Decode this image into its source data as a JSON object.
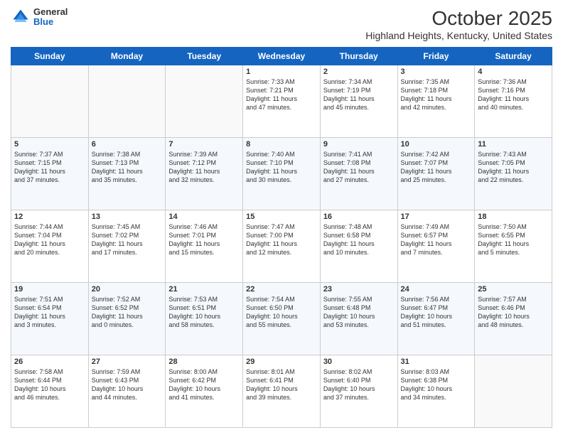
{
  "logo": {
    "general": "General",
    "blue": "Blue"
  },
  "title": "October 2025",
  "subtitle": "Highland Heights, Kentucky, United States",
  "days_header": [
    "Sunday",
    "Monday",
    "Tuesday",
    "Wednesday",
    "Thursday",
    "Friday",
    "Saturday"
  ],
  "weeks": [
    {
      "cells": [
        {
          "day": "",
          "info": ""
        },
        {
          "day": "",
          "info": ""
        },
        {
          "day": "",
          "info": ""
        },
        {
          "day": "1",
          "info": "Sunrise: 7:33 AM\nSunset: 7:21 PM\nDaylight: 11 hours\nand 47 minutes."
        },
        {
          "day": "2",
          "info": "Sunrise: 7:34 AM\nSunset: 7:19 PM\nDaylight: 11 hours\nand 45 minutes."
        },
        {
          "day": "3",
          "info": "Sunrise: 7:35 AM\nSunset: 7:18 PM\nDaylight: 11 hours\nand 42 minutes."
        },
        {
          "day": "4",
          "info": "Sunrise: 7:36 AM\nSunset: 7:16 PM\nDaylight: 11 hours\nand 40 minutes."
        }
      ]
    },
    {
      "cells": [
        {
          "day": "5",
          "info": "Sunrise: 7:37 AM\nSunset: 7:15 PM\nDaylight: 11 hours\nand 37 minutes."
        },
        {
          "day": "6",
          "info": "Sunrise: 7:38 AM\nSunset: 7:13 PM\nDaylight: 11 hours\nand 35 minutes."
        },
        {
          "day": "7",
          "info": "Sunrise: 7:39 AM\nSunset: 7:12 PM\nDaylight: 11 hours\nand 32 minutes."
        },
        {
          "day": "8",
          "info": "Sunrise: 7:40 AM\nSunset: 7:10 PM\nDaylight: 11 hours\nand 30 minutes."
        },
        {
          "day": "9",
          "info": "Sunrise: 7:41 AM\nSunset: 7:08 PM\nDaylight: 11 hours\nand 27 minutes."
        },
        {
          "day": "10",
          "info": "Sunrise: 7:42 AM\nSunset: 7:07 PM\nDaylight: 11 hours\nand 25 minutes."
        },
        {
          "day": "11",
          "info": "Sunrise: 7:43 AM\nSunset: 7:05 PM\nDaylight: 11 hours\nand 22 minutes."
        }
      ]
    },
    {
      "cells": [
        {
          "day": "12",
          "info": "Sunrise: 7:44 AM\nSunset: 7:04 PM\nDaylight: 11 hours\nand 20 minutes."
        },
        {
          "day": "13",
          "info": "Sunrise: 7:45 AM\nSunset: 7:02 PM\nDaylight: 11 hours\nand 17 minutes."
        },
        {
          "day": "14",
          "info": "Sunrise: 7:46 AM\nSunset: 7:01 PM\nDaylight: 11 hours\nand 15 minutes."
        },
        {
          "day": "15",
          "info": "Sunrise: 7:47 AM\nSunset: 7:00 PM\nDaylight: 11 hours\nand 12 minutes."
        },
        {
          "day": "16",
          "info": "Sunrise: 7:48 AM\nSunset: 6:58 PM\nDaylight: 11 hours\nand 10 minutes."
        },
        {
          "day": "17",
          "info": "Sunrise: 7:49 AM\nSunset: 6:57 PM\nDaylight: 11 hours\nand 7 minutes."
        },
        {
          "day": "18",
          "info": "Sunrise: 7:50 AM\nSunset: 6:55 PM\nDaylight: 11 hours\nand 5 minutes."
        }
      ]
    },
    {
      "cells": [
        {
          "day": "19",
          "info": "Sunrise: 7:51 AM\nSunset: 6:54 PM\nDaylight: 11 hours\nand 3 minutes."
        },
        {
          "day": "20",
          "info": "Sunrise: 7:52 AM\nSunset: 6:52 PM\nDaylight: 11 hours\nand 0 minutes."
        },
        {
          "day": "21",
          "info": "Sunrise: 7:53 AM\nSunset: 6:51 PM\nDaylight: 10 hours\nand 58 minutes."
        },
        {
          "day": "22",
          "info": "Sunrise: 7:54 AM\nSunset: 6:50 PM\nDaylight: 10 hours\nand 55 minutes."
        },
        {
          "day": "23",
          "info": "Sunrise: 7:55 AM\nSunset: 6:48 PM\nDaylight: 10 hours\nand 53 minutes."
        },
        {
          "day": "24",
          "info": "Sunrise: 7:56 AM\nSunset: 6:47 PM\nDaylight: 10 hours\nand 51 minutes."
        },
        {
          "day": "25",
          "info": "Sunrise: 7:57 AM\nSunset: 6:46 PM\nDaylight: 10 hours\nand 48 minutes."
        }
      ]
    },
    {
      "cells": [
        {
          "day": "26",
          "info": "Sunrise: 7:58 AM\nSunset: 6:44 PM\nDaylight: 10 hours\nand 46 minutes."
        },
        {
          "day": "27",
          "info": "Sunrise: 7:59 AM\nSunset: 6:43 PM\nDaylight: 10 hours\nand 44 minutes."
        },
        {
          "day": "28",
          "info": "Sunrise: 8:00 AM\nSunset: 6:42 PM\nDaylight: 10 hours\nand 41 minutes."
        },
        {
          "day": "29",
          "info": "Sunrise: 8:01 AM\nSunset: 6:41 PM\nDaylight: 10 hours\nand 39 minutes."
        },
        {
          "day": "30",
          "info": "Sunrise: 8:02 AM\nSunset: 6:40 PM\nDaylight: 10 hours\nand 37 minutes."
        },
        {
          "day": "31",
          "info": "Sunrise: 8:03 AM\nSunset: 6:38 PM\nDaylight: 10 hours\nand 34 minutes."
        },
        {
          "day": "",
          "info": ""
        }
      ]
    }
  ]
}
